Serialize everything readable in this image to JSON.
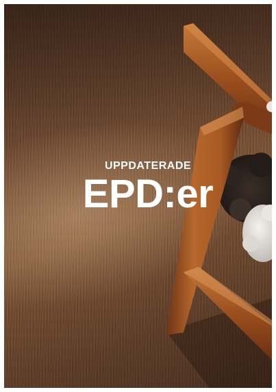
{
  "cover": {
    "subtitle": "UPPDATERADE",
    "title": "EPD:er"
  },
  "colors": {
    "background": "#ffffff",
    "floor": "#6a4832",
    "wood": "#9a5526",
    "text": "#ffffff"
  }
}
